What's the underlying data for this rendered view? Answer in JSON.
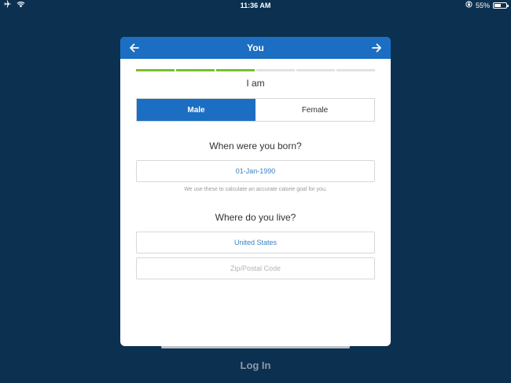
{
  "status_bar": {
    "time": "11:36 AM",
    "battery": "55%",
    "battery_level": 0.55,
    "icons": [
      "airplane-icon",
      "wifi-icon",
      "orientation-lock-icon",
      "battery-icon"
    ]
  },
  "header": {
    "title": "You",
    "back_icon": "arrow-left-icon",
    "next_icon": "arrow-right-icon",
    "background": "#1c6ec2"
  },
  "progress": {
    "total_steps": 6,
    "completed_steps": 3,
    "done_color": "#7cbd2e"
  },
  "gender": {
    "label": "I am",
    "options": [
      "Male",
      "Female"
    ],
    "selected": "Male"
  },
  "birth": {
    "question": "When were you born?",
    "value": "01-Jan-1990",
    "hint": "We use these to calculate an accurate calorie goal for you."
  },
  "location": {
    "question": "Where do you live?",
    "country": "United States",
    "zip_placeholder": "Zip/Postal Code"
  },
  "footer": {
    "login_label": "Log In"
  }
}
